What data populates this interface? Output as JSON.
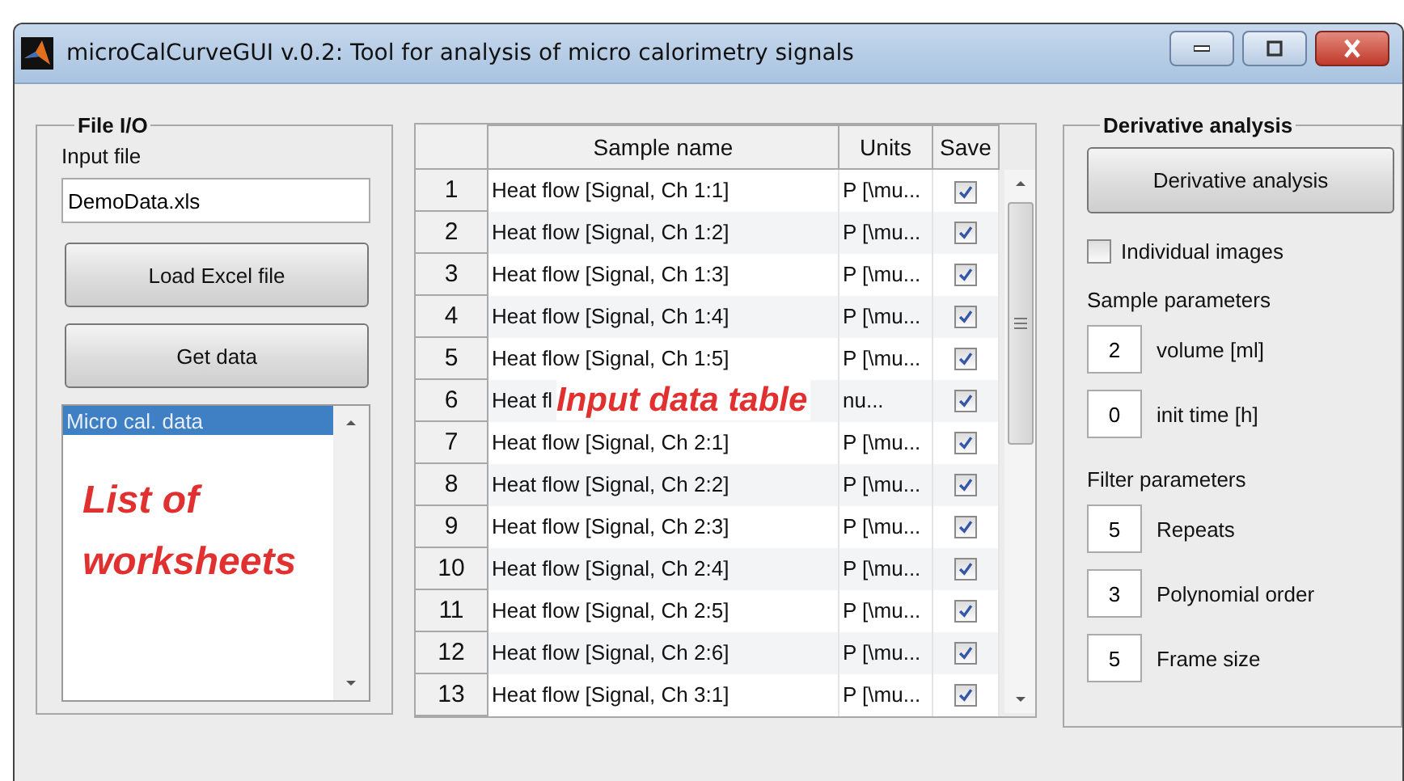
{
  "window": {
    "title": "microCalCurveGUI v.0.2: Tool for analysis of micro calorimetry signals"
  },
  "file_io": {
    "title": "File I/O",
    "input_label": "Input file",
    "input_value": "DemoData.xls",
    "buttons": [
      "Load Excel file",
      "Get data"
    ],
    "worksheets": [
      {
        "label": "Micro cal. data",
        "selected": true
      }
    ],
    "annotation": "List of worksheets"
  },
  "table": {
    "columns": [
      "Sample name",
      "Units",
      "Save"
    ],
    "rows": [
      {
        "index": "1",
        "sample_name": "Heat flow [Signal, Ch 1:1]",
        "units": "P [\\mu...",
        "save": true
      },
      {
        "index": "2",
        "sample_name": "Heat flow [Signal, Ch 1:2]",
        "units": "P [\\mu...",
        "save": true
      },
      {
        "index": "3",
        "sample_name": "Heat flow [Signal, Ch 1:3]",
        "units": "P [\\mu...",
        "save": true
      },
      {
        "index": "4",
        "sample_name": "Heat flow [Signal, Ch 1:4]",
        "units": "P [\\mu...",
        "save": true
      },
      {
        "index": "5",
        "sample_name": "Heat flow [Signal, Ch 1:5]",
        "units": "P [\\mu...",
        "save": true
      },
      {
        "index": "6",
        "sample_name": "Heat fl",
        "units": "nu...",
        "save": true,
        "annotation": "Input data table"
      },
      {
        "index": "7",
        "sample_name": "Heat flow [Signal, Ch 2:1]",
        "units": "P [\\mu...",
        "save": true
      },
      {
        "index": "8",
        "sample_name": "Heat flow [Signal, Ch 2:2]",
        "units": "P [\\mu...",
        "save": true
      },
      {
        "index": "9",
        "sample_name": "Heat flow [Signal, Ch 2:3]",
        "units": "P [\\mu...",
        "save": true
      },
      {
        "index": "10",
        "sample_name": "Heat flow [Signal, Ch 2:4]",
        "units": "P [\\mu...",
        "save": true
      },
      {
        "index": "11",
        "sample_name": "Heat flow [Signal, Ch 2:5]",
        "units": "P [\\mu...",
        "save": true
      },
      {
        "index": "12",
        "sample_name": "Heat flow [Signal, Ch 2:6]",
        "units": "P [\\mu...",
        "save": true
      },
      {
        "index": "13",
        "sample_name": "Heat flow [Signal, Ch 3:1]",
        "units": "P [\\mu...",
        "save": true
      }
    ]
  },
  "derivative": {
    "title": "Derivative analysis",
    "button": "Derivative analysis",
    "individual_images": {
      "label": "Individual images",
      "checked": false
    },
    "sample_parameters": {
      "title": "Sample parameters",
      "fields": [
        {
          "value": "2",
          "label": "volume [ml]"
        },
        {
          "value": "0",
          "label": "init time [h]"
        }
      ]
    },
    "filter_parameters": {
      "title": "Filter parameters",
      "fields": [
        {
          "value": "5",
          "label": "Repeats"
        },
        {
          "value": "3",
          "label": "Polynomial order"
        },
        {
          "value": "5",
          "label": "Frame size"
        }
      ]
    }
  }
}
